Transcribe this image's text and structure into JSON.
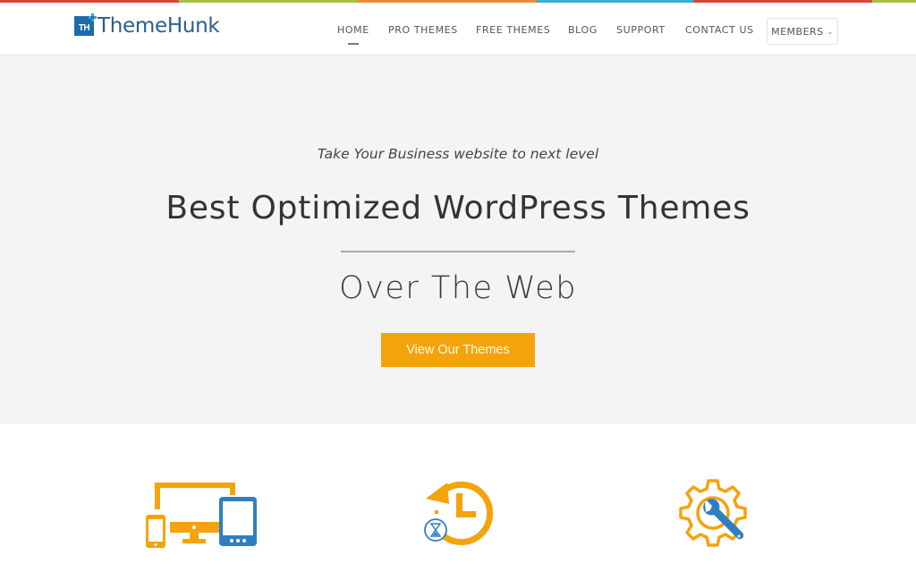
{
  "colors": {
    "strip": [
      "#d9473b",
      "#a5c23c",
      "#ed8c36",
      "#37afd7",
      "#d9473b",
      "#a5c23c",
      "#ed8c36",
      "#37afd7"
    ],
    "accent": "#f5a30c",
    "brand_blue": "#1f6aa8",
    "icon_blue": "#2e7fc2",
    "hero_bg": "#f4f4f5"
  },
  "header": {
    "logo": {
      "badge_text": "TH",
      "name": "ThemeHunk"
    },
    "nav": [
      {
        "label": "HOME",
        "active": true
      },
      {
        "label": "PRO THEMES",
        "active": false
      },
      {
        "label": "FREE THEMES",
        "active": false
      },
      {
        "label": "BLOG",
        "active": false
      },
      {
        "label": "SUPPORT",
        "active": false
      },
      {
        "label": "CONTACT US",
        "active": false
      }
    ],
    "members": {
      "label": "MEMBERS",
      "icon": "chevron-down-icon"
    }
  },
  "hero": {
    "tagline": "Take Your Business website to next level",
    "title": "Best Optimized WordPress Themes",
    "subtitle": "Over The Web",
    "cta_label": "View Our Themes"
  },
  "features": [
    {
      "icon": "responsive-devices-icon"
    },
    {
      "icon": "history-clock-icon"
    },
    {
      "icon": "gear-wrench-icon"
    }
  ]
}
